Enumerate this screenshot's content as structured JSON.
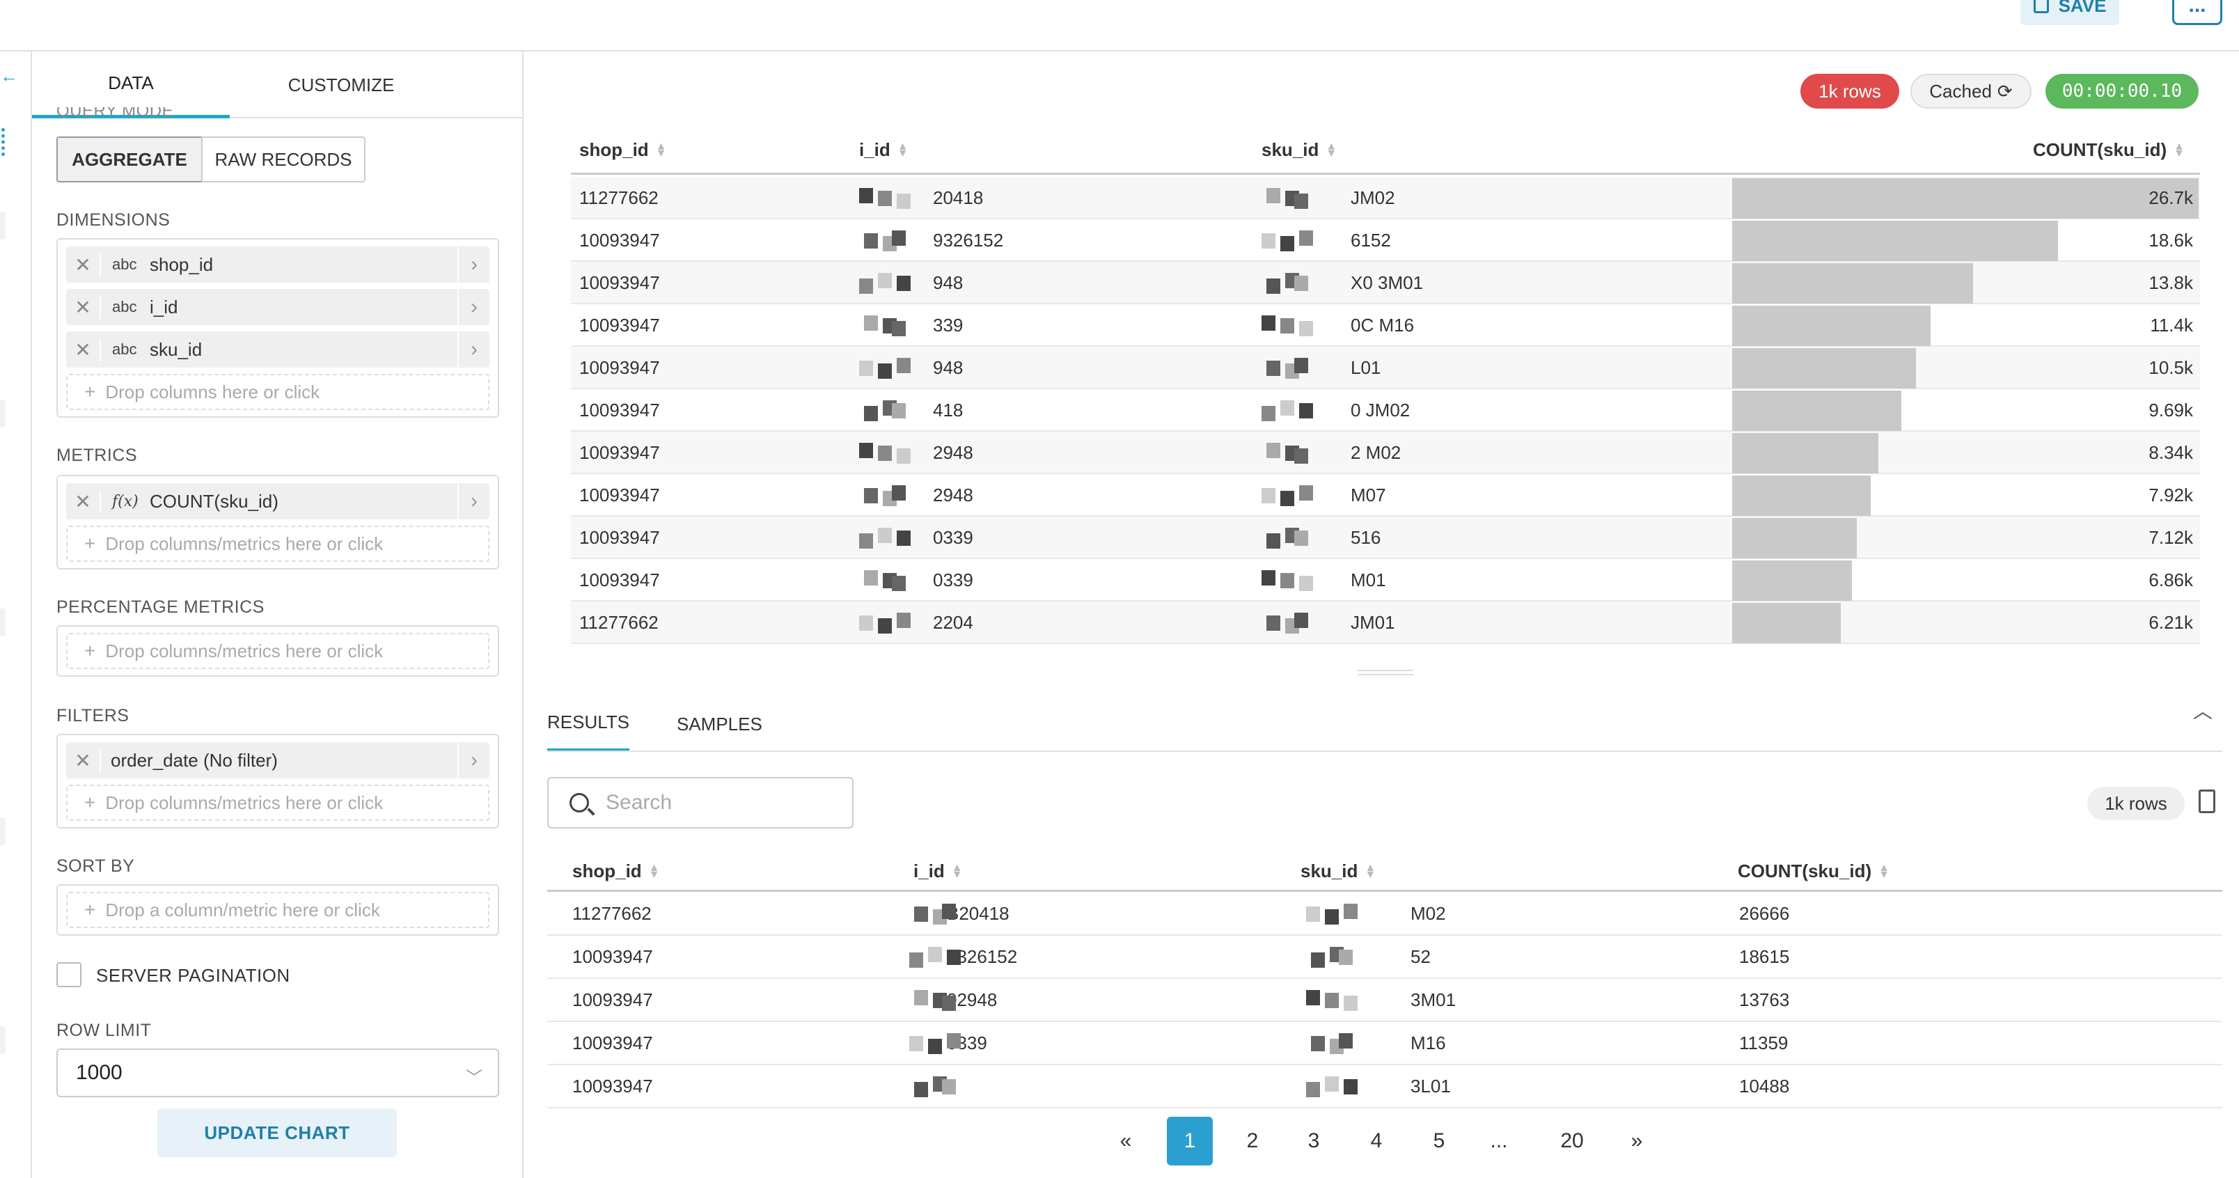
{
  "topbar": {
    "save_label": "SAVE",
    "more_label": "..."
  },
  "panel": {
    "tabs": [
      "DATA",
      "CUSTOMIZE"
    ],
    "query_mode_label": "QUERY MODE",
    "query_modes": [
      "AGGREGATE",
      "RAW RECORDS"
    ],
    "dimensions": {
      "label": "DIMENSIONS",
      "items": [
        {
          "type": "abc",
          "label": "shop_id"
        },
        {
          "type": "abc",
          "label": "i_id"
        },
        {
          "type": "abc",
          "label": "sku_id"
        }
      ],
      "drop": "Drop columns here or click"
    },
    "metrics": {
      "label": "METRICS",
      "items": [
        {
          "type": "f(x)",
          "label": "COUNT(sku_id)"
        }
      ],
      "drop": "Drop columns/metrics here or click"
    },
    "percentage_metrics": {
      "label": "PERCENTAGE METRICS",
      "drop": "Drop columns/metrics here or click"
    },
    "filters": {
      "label": "FILTERS",
      "items": [
        {
          "label": "order_date (No filter)"
        }
      ],
      "drop": "Drop columns/metrics here or click"
    },
    "sort_by": {
      "label": "SORT BY",
      "drop": "Drop a column/metric here or click"
    },
    "server_pagination": {
      "label": "SERVER PAGINATION",
      "checked": false
    },
    "row_limit": {
      "label": "ROW LIMIT",
      "value": "1000"
    },
    "update_label": "UPDATE CHART"
  },
  "status": {
    "rows": "1k rows",
    "cached": "Cached",
    "timer": "00:00:00.10",
    "rows_color": "#d9534f",
    "timer_color": "#5cb85c"
  },
  "chart_table": {
    "columns": [
      "shop_id",
      "i_id",
      "sku_id",
      "COUNT(sku_id)"
    ],
    "rows": [
      {
        "shop_id": "11277662",
        "i_id": "20418",
        "sku_id": "JM02",
        "count": "26.7k",
        "value": 26666
      },
      {
        "shop_id": "10093947",
        "i_id": "9326152",
        "sku_id": "6152",
        "count": "18.6k",
        "value": 18615
      },
      {
        "shop_id": "10093947",
        "i_id": "948",
        "sku_id": "X0 3M01",
        "count": "13.8k",
        "value": 13763
      },
      {
        "shop_id": "10093947",
        "i_id": "339",
        "sku_id": "0C M16",
        "count": "11.4k",
        "value": 11359
      },
      {
        "shop_id": "10093947",
        "i_id": "948",
        "sku_id": "L01",
        "count": "10.5k",
        "value": 10488
      },
      {
        "shop_id": "10093947",
        "i_id": "418",
        "sku_id": "0 JM02",
        "count": "9.69k",
        "value": 9690
      },
      {
        "shop_id": "10093947",
        "i_id": "2948",
        "sku_id": "2 M02",
        "count": "8.34k",
        "value": 8340
      },
      {
        "shop_id": "10093947",
        "i_id": "2948",
        "sku_id": "M07",
        "count": "7.92k",
        "value": 7920
      },
      {
        "shop_id": "10093947",
        "i_id": "0339",
        "sku_id": "516",
        "count": "7.12k",
        "value": 7120
      },
      {
        "shop_id": "10093947",
        "i_id": "0339",
        "sku_id": "M01",
        "count": "6.86k",
        "value": 6860
      },
      {
        "shop_id": "11277662",
        "i_id": "2204",
        "sku_id": "JM01",
        "count": "6.21k",
        "value": 6210
      }
    ]
  },
  "results": {
    "tabs": [
      "RESULTS",
      "SAMPLES"
    ],
    "search_placeholder": "Search",
    "rows_badge": "1k rows",
    "columns": [
      "shop_id",
      "i_id",
      "sku_id",
      "COUNT(sku_id)"
    ],
    "rows": [
      {
        "shop_id": "11277662",
        "i_id": "B20418",
        "sku_id": "M02",
        "count": "26666"
      },
      {
        "shop_id": "10093947",
        "i_id": "9326152",
        "sku_id": "52",
        "count": "18615"
      },
      {
        "shop_id": "10093947",
        "i_id": "02948",
        "sku_id": "3M01",
        "count": "13763"
      },
      {
        "shop_id": "10093947",
        "i_id": "0339",
        "sku_id": "M16",
        "count": "11359"
      },
      {
        "shop_id": "10093947",
        "i_id": "",
        "sku_id": "3L01",
        "count": "10488"
      }
    ],
    "pagination": [
      "«",
      "1",
      "2",
      "3",
      "4",
      "5",
      "...",
      "20",
      "»"
    ],
    "current_page": "1"
  }
}
